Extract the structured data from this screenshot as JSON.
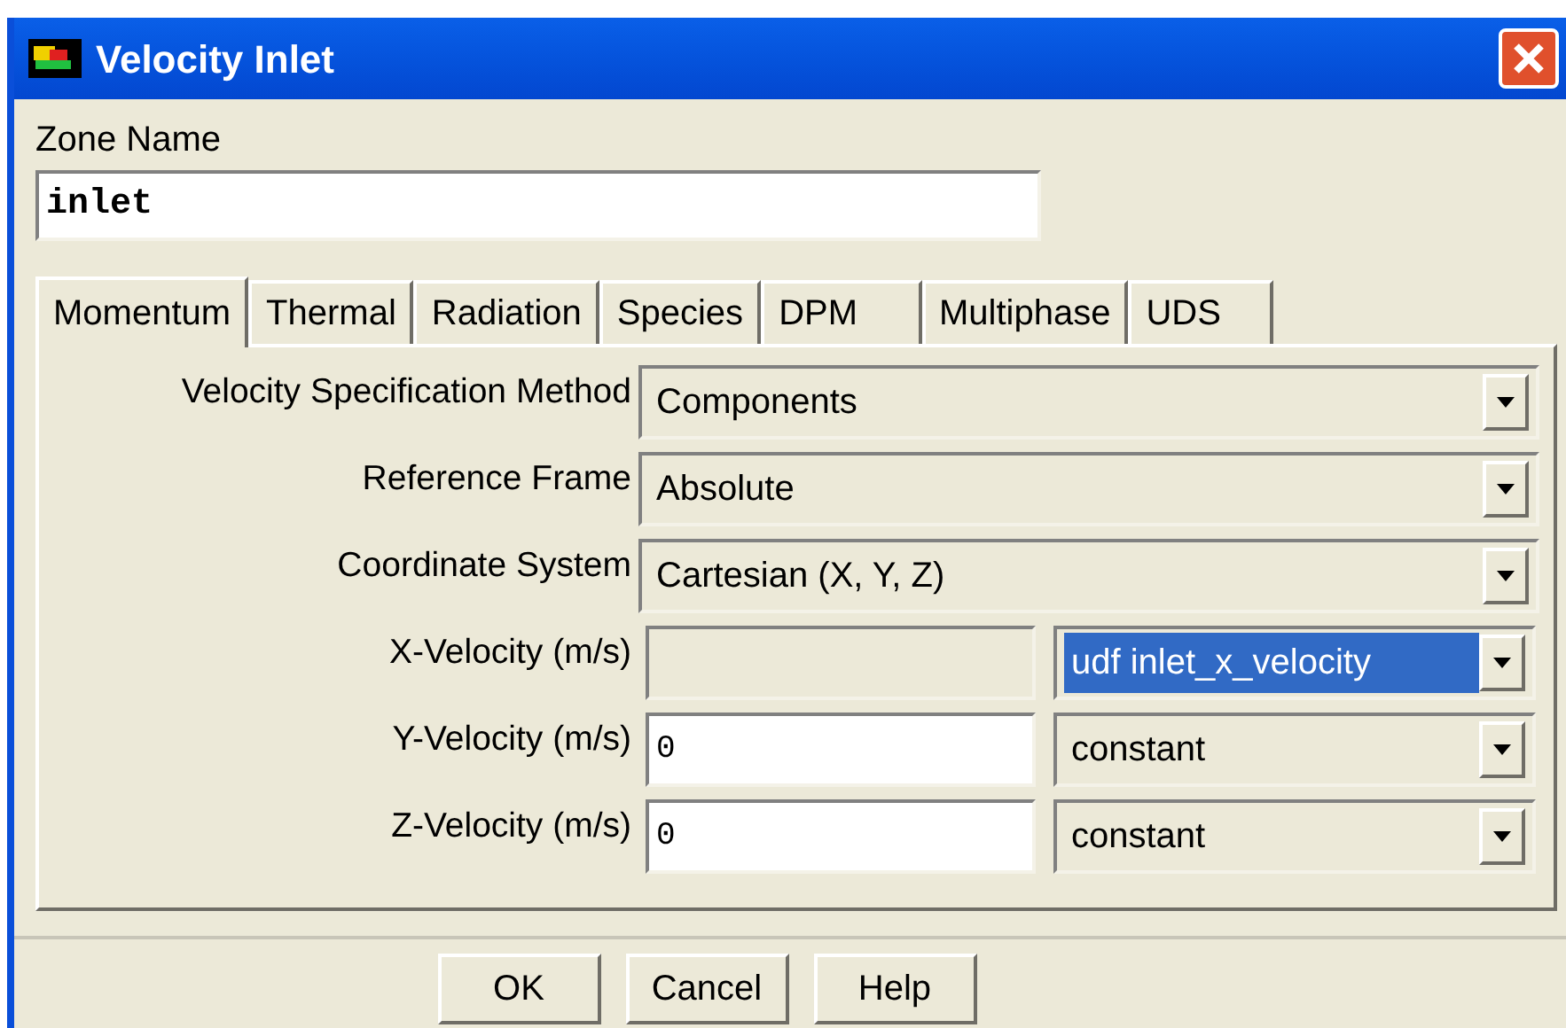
{
  "window": {
    "title": "Velocity Inlet"
  },
  "zone_name": {
    "label": "Zone Name",
    "value": "inlet"
  },
  "tabs": [
    {
      "label": "Momentum",
      "selected": true
    },
    {
      "label": "Thermal",
      "selected": false
    },
    {
      "label": "Radiation",
      "selected": false
    },
    {
      "label": "Species",
      "selected": false
    },
    {
      "label": "DPM",
      "selected": false
    },
    {
      "label": "Multiphase",
      "selected": false
    },
    {
      "label": "UDS",
      "selected": false
    }
  ],
  "rows": [
    {
      "kind": "dropdown",
      "label": "Velocity Specification Method",
      "value": "Components"
    },
    {
      "kind": "dropdown",
      "label": "Reference Frame",
      "value": "Absolute"
    },
    {
      "kind": "dropdown",
      "label": "Coordinate System",
      "value": "Cartesian (X, Y, Z)"
    },
    {
      "kind": "component",
      "label": "X-Velocity (m/s)",
      "disabled": true,
      "method": "udf inlet_x_velocity",
      "highlighted": true
    },
    {
      "kind": "component",
      "label": "Y-Velocity (m/s)",
      "disabled": false,
      "value": "0",
      "method": "constant",
      "highlighted": false
    },
    {
      "kind": "component",
      "label": "Z-Velocity (m/s)",
      "disabled": false,
      "value": "0",
      "method": "constant",
      "highlighted": false
    }
  ],
  "buttons": [
    "OK",
    "Cancel",
    "Help"
  ]
}
